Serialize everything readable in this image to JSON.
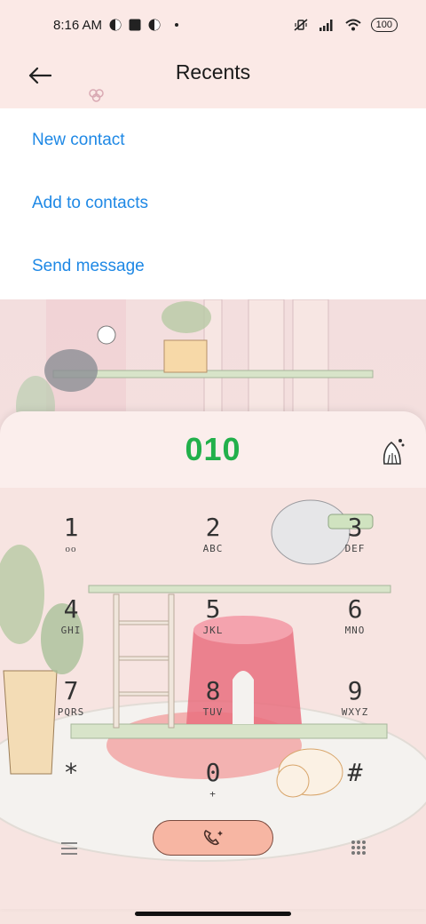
{
  "status_bar": {
    "time": "8:16 AM",
    "battery": "100",
    "icons": [
      "notification-icon",
      "square-icon",
      "notification-icon",
      "dot",
      "vibrate-off-icon",
      "signal-icon",
      "wifi-icon",
      "battery-icon"
    ]
  },
  "header": {
    "title": "Recents",
    "back_icon": "arrow-left-icon"
  },
  "menu": {
    "items": [
      "New contact",
      "Add to contacts",
      "Send message"
    ]
  },
  "dialer": {
    "number": "010",
    "clear_icon": "broom-icon",
    "keys": [
      {
        "digit": "1",
        "letters": "ᴏᴏ"
      },
      {
        "digit": "2",
        "letters": "ABC"
      },
      {
        "digit": "3",
        "letters": "DEF"
      },
      {
        "digit": "4",
        "letters": "GHI"
      },
      {
        "digit": "5",
        "letters": "JKL"
      },
      {
        "digit": "6",
        "letters": "MNO"
      },
      {
        "digit": "7",
        "letters": "PQRS"
      },
      {
        "digit": "8",
        "letters": "TUV"
      },
      {
        "digit": "9",
        "letters": "WXYZ"
      },
      {
        "digit": "*",
        "letters": ""
      },
      {
        "digit": "0",
        "letters": "+"
      },
      {
        "digit": "#",
        "letters": ""
      }
    ],
    "call_icon": "phone-icon",
    "menu_icon": "hamburger-icon",
    "keypad_icon": "keypad-icon"
  },
  "colors": {
    "accent_blue": "#1e88e5",
    "number_green": "#22b04b",
    "call_button": "#f7b6a3",
    "background_pink": "#fbe9e6"
  }
}
